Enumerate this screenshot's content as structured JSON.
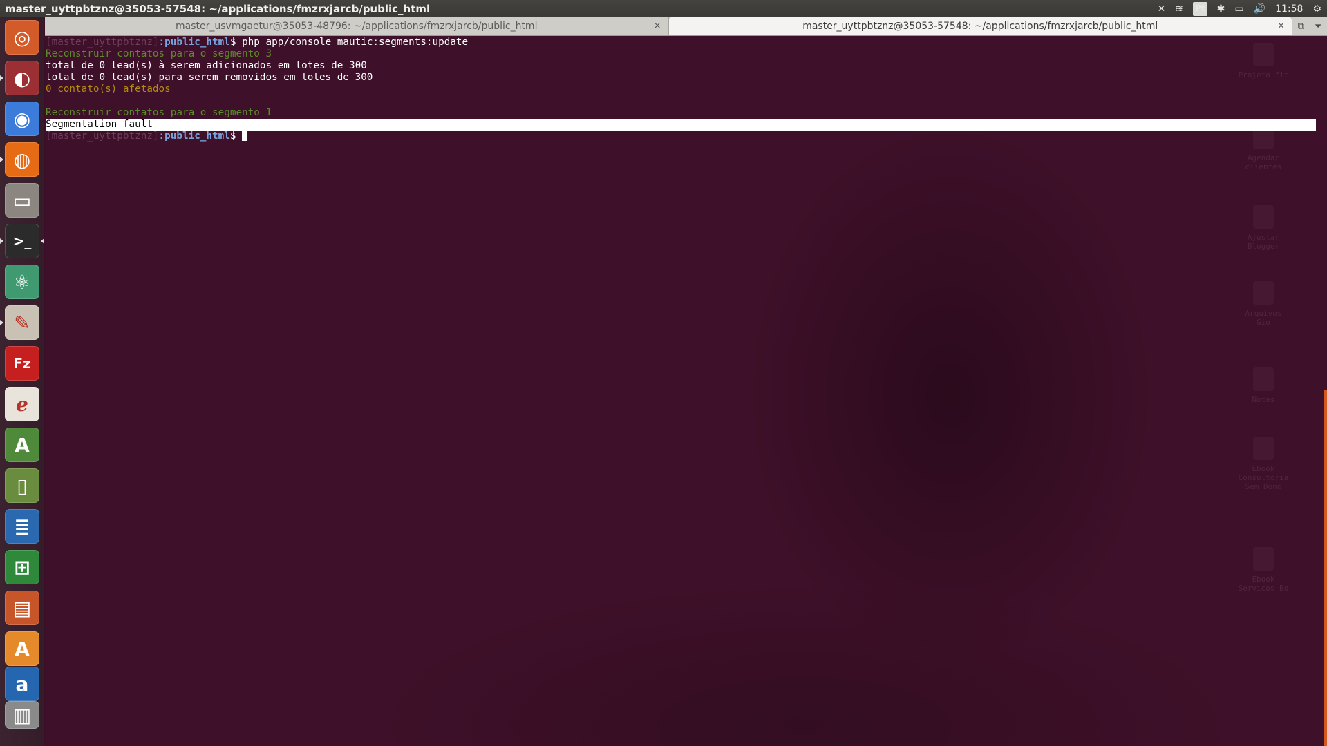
{
  "top_panel": {
    "title": "master_uyttpbtznz@35053-57548: ~/applications/fmzrxjarcb/public_html",
    "indicators": {
      "dropbox_icon": "✕",
      "wifi_icon": "≋",
      "keyboard_layout": "Pt",
      "bluetooth_icon": "✱",
      "battery_icon": "▭",
      "volume_icon": "🔊",
      "clock": "11:58",
      "settings_icon": "⚙"
    }
  },
  "launcher": {
    "items": [
      {
        "name": "ubuntu-dash",
        "glyph": "◎",
        "bg": "#d35b29"
      },
      {
        "name": "disk-utility",
        "glyph": "◐",
        "bg": "#9b2f34"
      },
      {
        "name": "chrome",
        "glyph": "◉",
        "bg": "#3b7bd9"
      },
      {
        "name": "firefox",
        "glyph": "◍",
        "bg": "#e66b14"
      },
      {
        "name": "files",
        "glyph": "▭",
        "bg": "#8b8680"
      },
      {
        "name": "terminal",
        "glyph": ">_",
        "bg": "#2b2b2b"
      },
      {
        "name": "atom",
        "glyph": "⚛",
        "bg": "#3f9a72"
      },
      {
        "name": "text-editor",
        "glyph": "✎",
        "bg": "#c9c2b4"
      },
      {
        "name": "filezilla",
        "glyph": "Fz",
        "bg": "#c51f1f"
      },
      {
        "name": "evince",
        "glyph": "ℯ",
        "bg": "#e8e4dc"
      },
      {
        "name": "android-studio",
        "glyph": "A",
        "bg": "#4f8a3a"
      },
      {
        "name": "tablet",
        "glyph": "▯",
        "bg": "#6a8c3e"
      },
      {
        "name": "libreoffice-writer",
        "glyph": "≣",
        "bg": "#2a68b0"
      },
      {
        "name": "libreoffice-calc",
        "glyph": "⊞",
        "bg": "#2e8a3a"
      },
      {
        "name": "libreoffice-impress",
        "glyph": "▤",
        "bg": "#c8542a"
      },
      {
        "name": "software-center",
        "glyph": "A",
        "bg": "#e58a2a"
      },
      {
        "name": "amazon",
        "glyph": "a",
        "bg": "#2466b0"
      },
      {
        "name": "trash",
        "glyph": "▥",
        "bg": "#8a8a8a"
      }
    ]
  },
  "tabs": [
    {
      "label": "master_usvmgaetur@35053-48796: ~/applications/fmzrxjarcb/public_html",
      "close": "×",
      "active": false
    },
    {
      "label": "master_uyttpbtznz@35053-57548: ~/applications/fmzrxjarcb/public_html",
      "close": "×",
      "active": true
    }
  ],
  "tab_menu": {
    "new_tab_icon": "⧉",
    "dropdown_icon": "⏷"
  },
  "terminal": {
    "prompt_user": "[master_uyttpbtznz]",
    "prompt_dir": ":public_html",
    "prompt_symbol": "$ ",
    "command": "php app/console mautic:segments:update",
    "lines": {
      "l2": "Reconstruir contatos para o segmento 3",
      "l3": "total de 0 lead(s) à serem adicionados em lotes de 300",
      "l4": "total de 0 lead(s) para serem removidos em lotes de 300",
      "l5": "0 contato(s) afetados",
      "l6": "",
      "l7": "Reconstruir contatos para o segmento 1",
      "l8": "Segmentation fault"
    }
  },
  "desktop_icons": [
    {
      "label": "Projeto fit"
    },
    {
      "label": "Agendar clientes"
    },
    {
      "label": "Ajustar Blogger"
    },
    {
      "label": "Arquivos Gio"
    },
    {
      "label": "Notes"
    },
    {
      "label": "Ebook Consultoria Sem Dono"
    },
    {
      "label": "Ebook Servicos Bo"
    }
  ]
}
